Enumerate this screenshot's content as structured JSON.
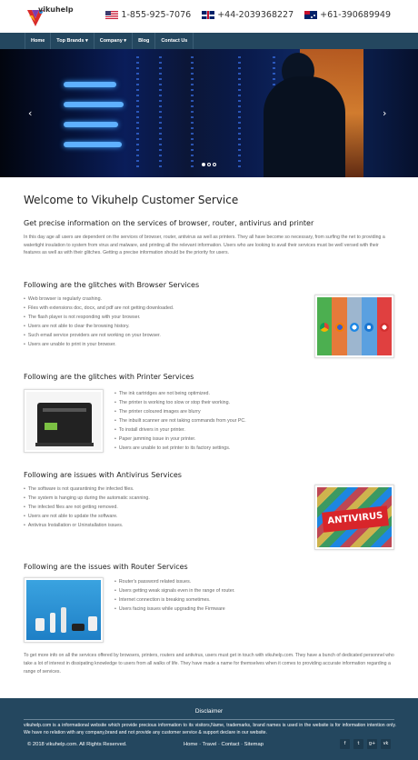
{
  "header": {
    "brand": "vikuhelp",
    "phones": [
      {
        "country": "US",
        "number": "1-855-925-7076"
      },
      {
        "country": "UK",
        "number": "+44-2039368227"
      },
      {
        "country": "AU",
        "number": "+61-390689949"
      }
    ]
  },
  "nav": {
    "items": [
      "Home",
      "Top Brands ▾",
      "Company ▾",
      "Blog",
      "Contact Us"
    ]
  },
  "hero": {
    "prev": "‹",
    "next": "›",
    "slides": 3,
    "active_slide": 1
  },
  "main": {
    "title": "Welcome to Vikuhelp Customer Service",
    "subtitle": "Get precise information on the services of browser, router, antivirus and printer",
    "intro": "In this day age all users are dependent on the services of browser, router, antivirus as well as printers. They all have become so necessary, from surfing the net to providing a watertight insulation to system from virus and malware, and printing all the relevant information. Users who are looking to avail their services must be well versed with their features as well as with their glitches. Getting a precise information should be the priority for users.",
    "browser": {
      "heading": "Following are the glitches with Browser Services",
      "items": [
        "Web browser is regularly crashing.",
        "Files with extensions doc, docx, and pdf are not getting downloaded.",
        "The flash player is not responding with your browser.",
        "Users are not able to clear the browsing history.",
        "Such email service providers are not working on your browser.",
        "Users are unable to print in your browser."
      ]
    },
    "printer": {
      "heading": "Following are the glitches with Printer Services",
      "items": [
        "The ink cartridges are not being optimized.",
        "The printer is working too slow or stop their working.",
        "The printer coloured images are blurry",
        "The inbuilt scanner are not taking commands from your PC.",
        "To install drivers in your printer.",
        "Paper jamming issue in your printer.",
        "Users are unable to set printer to its factory settings."
      ]
    },
    "antivirus": {
      "heading": "Following are issues with Antivirus Services",
      "items": [
        "The software is not quarantining the infected files.",
        "The system is hanging up during the automatic scanning.",
        "The infected files are not getting removed.",
        "Users are not able to update the software.",
        "Antivirus Installation or Uninstallation issues."
      ],
      "image_text": "ANTIVIRUS"
    },
    "router": {
      "heading": "Following are the issues with Router Services",
      "items": [
        "Router's password related issues.",
        "Users getting weak signals even in the range of router.",
        "Internet connection is breaking sometimes.",
        "Users facing issues while upgrading the Firmware"
      ]
    },
    "outro": "To get more info on all the services offered by browsers, printers, routers and antivirus, users must get in touch with vikuhelp.com. They have a bunch of dedicated personnel who take a lot of interest in dissipating knowledge to users from all walks of life. They have made a name for themselves when it comes to providing accurate information regarding a range of services."
  },
  "footer": {
    "disclaimer_title": "Disclaimer",
    "disclaimer": "vikuhelp.com is a informational website which provide precious information to its visitors,Name, trademarks, brand names is used in the website is for information intention only. We have no relation with any company,brand and not provide any customer service & support declare in our website.",
    "copyright": "© 2018 vikuhelp.com. All Rights Reserved.",
    "links": "Home · Travel · Contact · Sitemap",
    "social": [
      "f",
      "t",
      "g+",
      "vk"
    ]
  },
  "colors": {
    "nav": "#24475f",
    "footer": "#24475f",
    "accent": "#d92a2a"
  }
}
